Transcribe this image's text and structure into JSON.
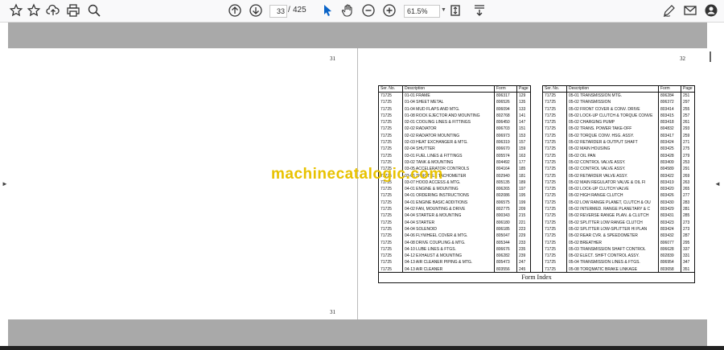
{
  "toolbar": {
    "current_page": "33",
    "separator": "/",
    "total_pages": "425",
    "zoom": "61.5%"
  },
  "pages": {
    "left_top_number": "31",
    "left_bottom_number": "31",
    "right_top_number": "32"
  },
  "table_headers": {
    "ser_no": "Ser. No.",
    "description": "Description",
    "form": "Form",
    "page": "Page"
  },
  "left_table": [
    [
      "71725",
      "01-01 FRAME",
      "806317",
      "129"
    ],
    [
      "71725",
      "01-04 SHEET METAL",
      "806526",
      "135"
    ],
    [
      "71725",
      "01-04 MUD FLAPS AND MTG.",
      "806094",
      "133"
    ],
    [
      "71725",
      "01-08 ROCK EJECTOR AND MOUNTING",
      "802768",
      "141"
    ],
    [
      "71725",
      "02-01 COOLING LINES & FITTINGS",
      "806450",
      "147"
    ],
    [
      "71725",
      "02-02 RADIATOR",
      "806703",
      "151"
    ],
    [
      "71725",
      "02-02 RADIATOR MOUNTING",
      "806973",
      "153"
    ],
    [
      "71725",
      "02-03 HEAT EXCHANGER & MTG.",
      "806319",
      "157"
    ],
    [
      "71725",
      "02-04 SHUTTER",
      "806670",
      "159"
    ],
    [
      "71725",
      "03-01 FUEL LINES & FITTINGS",
      "805574",
      "163"
    ],
    [
      "71725",
      "03-02 TANK & MOUNTING",
      "804492",
      "177"
    ],
    [
      "71725",
      "03-05 ACCELERATOR CONTROLS",
      "804164",
      "185"
    ],
    [
      "71725",
      "03-06 THROTTLE TACHOMETER",
      "802940",
      "181"
    ],
    [
      "71725",
      "03-07 HOOD ACCESS & MTG.",
      "805135",
      "189"
    ],
    [
      "71725",
      "04-01 ENGINE & MOUNTING",
      "806265",
      "197"
    ],
    [
      "71725",
      "04-01 ORDERING INSTRUCTIONS",
      "802086",
      "195"
    ],
    [
      "71725",
      "04-01 ENGINE BASIC ADDITIONS",
      "806575",
      "199"
    ],
    [
      "71725",
      "04-02 FAN, MOUNTING & DRIVE",
      "802775",
      "209"
    ],
    [
      "71725",
      "04-04 STARTER & MOUNTING",
      "800343",
      "215"
    ],
    [
      "71725",
      "04-04 STARTER",
      "806180",
      "221"
    ],
    [
      "71725",
      "04-04 SOLENOID",
      "806185",
      "223"
    ],
    [
      "71725",
      "04-06 FLYWHEEL COVER & MTG.",
      "805047",
      "229"
    ],
    [
      "71725",
      "04-08 DRIVE COUPLING & MTG.",
      "805344",
      "233"
    ],
    [
      "71725",
      "04-10 LUBE LINES & FTGS.",
      "806676",
      "235"
    ],
    [
      "71725",
      "04-12 EXHAUST & MOUNTING",
      "806282",
      "239"
    ],
    [
      "71725",
      "04-13 AIR CLEANER PIPING & MTG.",
      "805473",
      "247"
    ],
    [
      "71725",
      "04-13 AIR CLEANER",
      "803556",
      "245"
    ]
  ],
  "right_table": [
    [
      "71725",
      "05-01 TRANSMISSION MTG.",
      "806284",
      "251"
    ],
    [
      "71725",
      "05-02 TRANSMISSION",
      "806372",
      "297"
    ],
    [
      "71725",
      "05-02 FRONT COVER & CONV. DRIVE",
      "803414",
      "255"
    ],
    [
      "71725",
      "05-02 LOCK-UP CLUTCH & TORQUE CONVE",
      "803415",
      "257"
    ],
    [
      "71725",
      "05-02 CHARGING PUMP",
      "803418",
      "261"
    ],
    [
      "71725",
      "05-02 TRANS. POWER TAKE-OFF",
      "804832",
      "293"
    ],
    [
      "71725",
      "05-02 TORQUE CONV. HSG. ASSY.",
      "803417",
      "259"
    ],
    [
      "71725",
      "05-02 RETARDER & OUTPUT SHAFT",
      "803424",
      "271"
    ],
    [
      "71725",
      "05-02 MAIN HOUSING",
      "803425",
      "275"
    ],
    [
      "71725",
      "05-02 OIL PAN",
      "803428",
      "279"
    ],
    [
      "71725",
      "05-02 CONTROL VALVE ASSY.",
      "803409",
      "253"
    ],
    [
      "71725",
      "05-02 CONTROL VALVE ASSY.",
      "804589",
      "291"
    ],
    [
      "71725",
      "05-02 RETARDER VALVE ASSY.",
      "803422",
      "269"
    ],
    [
      "71725",
      "05-02 MAIN REGULATOR VALVE & OIL FI",
      "803419",
      "263"
    ],
    [
      "71725",
      "05-02 LOCK-UP CLUTCH VALVE",
      "803420",
      "265"
    ],
    [
      "71725",
      "05-02 HIGH RANGE CLUTCH",
      "803426",
      "277"
    ],
    [
      "71725",
      "05-02 LOW RANGE PLANET, CLUTCH & OU",
      "803430",
      "283"
    ],
    [
      "71725",
      "05-02 INTERMED. RANGE PLANETARY & C",
      "803429",
      "281"
    ],
    [
      "71725",
      "05-02 REVERSE RANGE PLAN. & CLUTCH",
      "803431",
      "285"
    ],
    [
      "71725",
      "05-02 SPLITTER LOW RANGE CLUTCH",
      "803423",
      "273"
    ],
    [
      "71725",
      "05-02 SPLITTER LOW-SPLITTER HI PLAN",
      "803424",
      "273"
    ],
    [
      "71725",
      "05-02 REAR CVR. & SPEEDOMETER",
      "803432",
      "287"
    ],
    [
      "71725",
      "05-02 BREATHER",
      "806077",
      "295"
    ],
    [
      "71725",
      "05-03 TRANSMISSION SHAFT CONTROL",
      "806628",
      "337"
    ],
    [
      "71725",
      "05-02 ELECT. SHIFT CONTROL ASSY.",
      "802839",
      "331"
    ],
    [
      "71725",
      "05-04 TRANSMISSION LINES & FTGS.",
      "806954",
      "347"
    ],
    [
      "71725",
      "05-08 TORQMATIC BRAKE LINKAGE",
      "803658",
      "351"
    ]
  ],
  "footer_label": "Form Index",
  "watermark": "machinecatalogic.com",
  "colors": {
    "toolbar_bg": "#f9f9fa",
    "gray_band": "#a9a9a9",
    "accent_blue": "#0a64c8",
    "watermark": "#e8c200"
  }
}
